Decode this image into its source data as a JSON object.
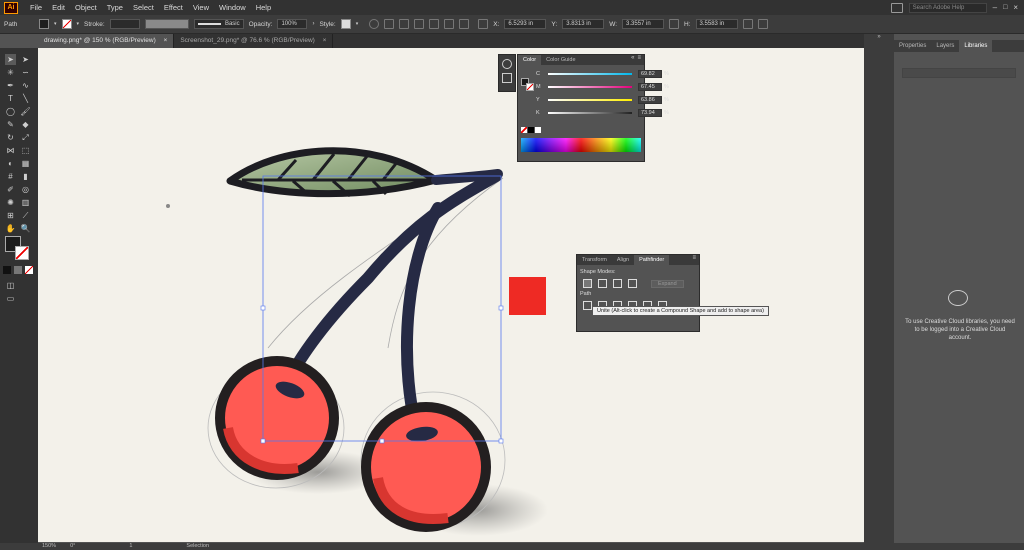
{
  "menubar": {
    "logo": "Ai",
    "items": [
      "File",
      "Edit",
      "Object",
      "Type",
      "Select",
      "Effect",
      "View",
      "Window",
      "Help"
    ],
    "search_placeholder": "Search Adobe Help"
  },
  "controlbar": {
    "selection_label": "Path",
    "stroke_label": "Stroke:",
    "brush_label": "Basic",
    "opacity_label": "Opacity:",
    "opacity_value": "100%",
    "style_label": "Style:",
    "x_value": "6.5293 in",
    "y_value": "3.8313 in",
    "w_value": "3.3557 in",
    "h_value": "3.5583 in"
  },
  "tabs": [
    {
      "label": "drawing.png* @ 150 % (RGB/Preview)"
    },
    {
      "label": "Screenshot_29.png* @ 76.6 % (RGB/Preview)"
    }
  ],
  "color_panel": {
    "tabs": [
      "Color",
      "Color Guide"
    ],
    "rows": [
      {
        "label": "C",
        "value": "69.82",
        "unit": "%"
      },
      {
        "label": "M",
        "value": "67.45",
        "unit": "%"
      },
      {
        "label": "Y",
        "value": "63.86",
        "unit": "%"
      },
      {
        "label": "K",
        "value": "73.94",
        "unit": "%"
      }
    ],
    "colors": {
      "C": "#00b7ec",
      "M": "#e4007c",
      "Y": "#ffee00",
      "K": "#222222"
    }
  },
  "pathfinder_panel": {
    "tabs": [
      "Transform",
      "Align",
      "Pathfinder"
    ],
    "shape_modes_label": "Shape Modes:",
    "expand_label": "Expand",
    "pathfinders_label": "Path",
    "tooltip": "Unite (Alt-click to create a Compound Shape and add to shape area)"
  },
  "libraries_panel": {
    "tabs": [
      "Properties",
      "Layers",
      "Libraries"
    ],
    "message": "To use Creative Cloud libraries, you need to be logged into a Creative Cloud account."
  },
  "statusbar": {
    "zoom": "150%",
    "rotation": "0°",
    "artboard": "1",
    "tool": "Selection"
  },
  "canvas": {
    "red_square_color": "#ee2a24",
    "cherry_color": "#ff5a53",
    "stem_color": "#262a44",
    "leaf_color": "#8fa57e"
  }
}
